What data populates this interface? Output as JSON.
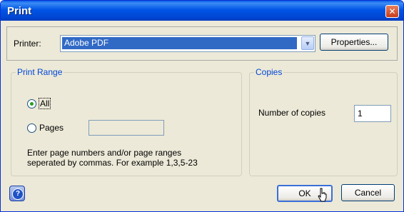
{
  "window": {
    "title": "Print",
    "close_symbol": "✕"
  },
  "printer": {
    "label": "Printer:",
    "selected": "Adobe PDF",
    "properties_label": "Properties..."
  },
  "print_range": {
    "legend": "Print Range",
    "all_label": "All",
    "pages_label": "Pages",
    "pages_value": "",
    "selected": "All",
    "hint_line1": "Enter page numbers and/or page ranges",
    "hint_line2": "seperated by commas. For example 1,3,5-23"
  },
  "copies": {
    "legend": "Copies",
    "label": "Number of copies",
    "value": "1"
  },
  "buttons": {
    "ok": "OK",
    "cancel": "Cancel",
    "help_symbol": "?"
  },
  "colors": {
    "titlebar": "#0055e5",
    "selection": "#316ac5",
    "group_legend": "#0046d5",
    "dialog_bg": "#ece9d8"
  },
  "icons": {
    "help": "help-icon",
    "close": "close-icon",
    "dropdown": "chevron-down-icon",
    "cursor": "pointer-cursor-icon"
  }
}
